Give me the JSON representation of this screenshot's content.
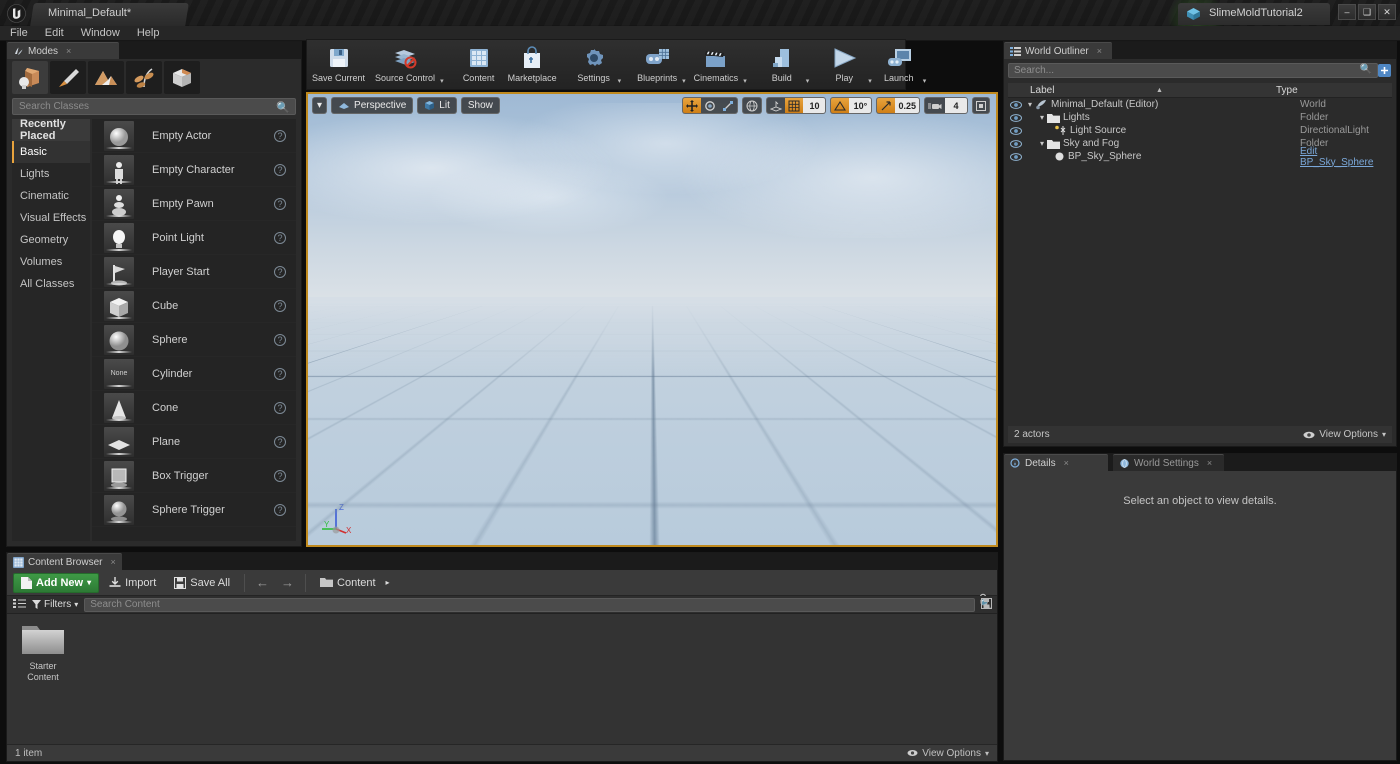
{
  "titlebar": {
    "logo": "unreal-logo",
    "project_tab": "Minimal_Default*",
    "right_tab": "SlimeMoldTutorial2",
    "minimize": "–",
    "maximize": "❑",
    "close": "✕"
  },
  "menubar": {
    "items": [
      "File",
      "Edit",
      "Window",
      "Help"
    ]
  },
  "modes": {
    "tab_label": "Modes",
    "tab_close": "×",
    "mode_tabs": [
      {
        "name": "place-mode",
        "active": true
      },
      {
        "name": "paint-mode",
        "active": false
      },
      {
        "name": "landscape-mode",
        "active": false
      },
      {
        "name": "foliage-mode",
        "active": false
      },
      {
        "name": "geometry-editing-mode",
        "active": false
      }
    ],
    "search_placeholder": "Search Classes",
    "categories": [
      {
        "label": "Recently Placed",
        "state": "header"
      },
      {
        "label": "Basic",
        "state": "active"
      },
      {
        "label": "Lights",
        "state": "normal"
      },
      {
        "label": "Cinematic",
        "state": "normal"
      },
      {
        "label": "Visual Effects",
        "state": "normal"
      },
      {
        "label": "Geometry",
        "state": "normal"
      },
      {
        "label": "Volumes",
        "state": "normal"
      },
      {
        "label": "All Classes",
        "state": "normal"
      }
    ],
    "items": [
      {
        "label": "Empty Actor",
        "thumb": "sphere"
      },
      {
        "label": "Empty Character",
        "thumb": "character"
      },
      {
        "label": "Empty Pawn",
        "thumb": "pawn"
      },
      {
        "label": "Point Light",
        "thumb": "bulb"
      },
      {
        "label": "Player Start",
        "thumb": "flag"
      },
      {
        "label": "Cube",
        "thumb": "cube"
      },
      {
        "label": "Sphere",
        "thumb": "sphere"
      },
      {
        "label": "Cylinder",
        "thumb": "none"
      },
      {
        "label": "Cone",
        "thumb": "cone"
      },
      {
        "label": "Plane",
        "thumb": "plane"
      },
      {
        "label": "Box Trigger",
        "thumb": "boxtrigger"
      },
      {
        "label": "Sphere Trigger",
        "thumb": "spheretrigger"
      }
    ],
    "help_glyph": "?"
  },
  "toolbar": {
    "buttons": [
      {
        "label": "Save Current",
        "icon": "save-icon",
        "caret": false
      },
      {
        "label": "Source Control",
        "icon": "source-control-icon",
        "caret": true
      },
      {
        "label": "Content",
        "icon": "content-icon",
        "caret": false
      },
      {
        "label": "Marketplace",
        "icon": "marketplace-icon",
        "caret": false
      },
      {
        "label": "Settings",
        "icon": "settings-icon",
        "caret": true
      },
      {
        "label": "Blueprints",
        "icon": "blueprints-icon",
        "caret": true
      },
      {
        "label": "Cinematics",
        "icon": "cinematics-icon",
        "caret": true
      },
      {
        "label": "Build",
        "icon": "build-icon",
        "caret": true
      },
      {
        "label": "Play",
        "icon": "play-icon",
        "caret": true
      },
      {
        "label": "Launch",
        "icon": "launch-icon",
        "caret": true
      }
    ]
  },
  "viewport": {
    "menu_caret": "▾",
    "view_mode": "Perspective",
    "lit_mode": "Lit",
    "show_menu": "Show",
    "transform_tools": [
      "translate",
      "rotate",
      "scale"
    ],
    "coord_system": "world-icon",
    "surface_snap": "surface-snap-icon",
    "grid_snap_on": true,
    "grid_snap_value": "10",
    "angle_snap_on": true,
    "angle_snap_value": "10°",
    "scale_snap_on": true,
    "scale_snap_value": "0.25",
    "camera_speed_value": "4",
    "maximize_icon": "maximize-viewport-icon",
    "gizmo": {
      "x": "X",
      "y": "Y",
      "z": "Z"
    }
  },
  "outliner": {
    "tab_label": "World Outliner",
    "tab_close": "×",
    "search_placeholder": "Search...",
    "columns": {
      "label": "Label",
      "type": "Type"
    },
    "rows": [
      {
        "label": "Minimal_Default (Editor)",
        "type": "World",
        "indent": 0,
        "icon": "world-icon",
        "expander": "▾",
        "link": false
      },
      {
        "label": "Lights",
        "type": "Folder",
        "indent": 1,
        "icon": "folder-icon",
        "expander": "▾",
        "link": false
      },
      {
        "label": "Light Source",
        "type": "DirectionalLight",
        "indent": 2,
        "icon": "light-icon",
        "expander": "",
        "link": false
      },
      {
        "label": "Sky and Fog",
        "type": "Folder",
        "indent": 1,
        "icon": "folder-icon",
        "expander": "▾",
        "link": false
      },
      {
        "label": "BP_Sky_Sphere",
        "type": "Edit BP_Sky_Sphere",
        "indent": 2,
        "icon": "sphere-icon",
        "expander": "",
        "link": true
      }
    ],
    "footer_count": "2 actors",
    "view_options": "View Options"
  },
  "details": {
    "tabs": [
      {
        "label": "Details",
        "icon": "details-icon",
        "active": true
      },
      {
        "label": "World Settings",
        "icon": "world-settings-icon",
        "active": false
      }
    ],
    "tab_close": "×",
    "empty_message": "Select an object to view details."
  },
  "content_browser": {
    "tab_label": "Content Browser",
    "tab_close": "×",
    "add_new": "Add New",
    "add_new_caret": "▾",
    "import": "Import",
    "save_all": "Save All",
    "nav_back": "←",
    "nav_forward": "→",
    "breadcrumb": "Content",
    "breadcrumb_caret": "▸",
    "lock_icon": "lock-icon",
    "filters": "Filters",
    "filters_caret": "▾",
    "search_placeholder": "Search Content",
    "assets": [
      {
        "name": "Starter\nContent",
        "line1": "Starter",
        "line2": "Content",
        "type": "folder"
      }
    ],
    "footer_count": "1 item",
    "view_options": "View Options"
  },
  "colors": {
    "accent_orange": "#e8a33d",
    "viewport_border": "#c08a1e",
    "add_new_green": "#3f9a46",
    "link_blue": "#7aa7d8",
    "panel_bg": "#2b2b2b",
    "dark_bg": "#1b1b1b"
  }
}
